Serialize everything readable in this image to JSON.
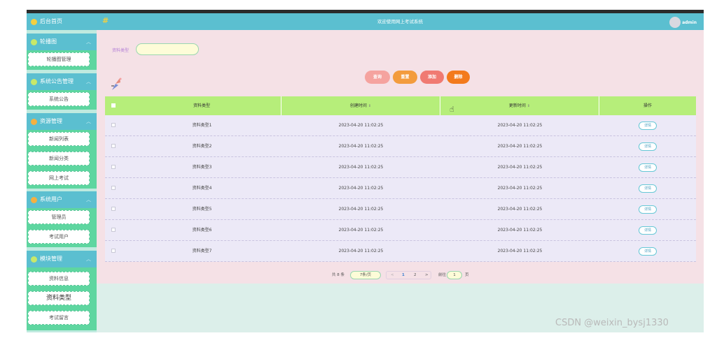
{
  "header": {
    "site_title": "欢迎使用网上考试系统",
    "admin_name": "admin"
  },
  "sidebar": {
    "home": "后台首页",
    "groups": [
      {
        "label": "轮播图",
        "items": [
          "轮播图管理"
        ]
      },
      {
        "label": "系统公告管理",
        "items": [
          "系统公告"
        ]
      },
      {
        "label": "资源管理",
        "items": [
          "新闻列表",
          "新闻分类",
          "网上考试"
        ]
      },
      {
        "label": "系统用户",
        "items": [
          "管理员",
          "考试用户"
        ]
      },
      {
        "label": "模块管理",
        "items": [
          "资料信息",
          "资料类型",
          "考试留言"
        ]
      }
    ]
  },
  "filter": {
    "label": "资料类型",
    "value": ""
  },
  "buttons": {
    "search": "查询",
    "reset": "重置",
    "add": "添加",
    "delete": "删除"
  },
  "table": {
    "columns": [
      "资料类型",
      "创建时间",
      "更新时间",
      "操作"
    ],
    "rows": [
      {
        "type": "资料类型1",
        "created": "2023-04-20 11:02:25",
        "updated": "2023-04-20 11:02:25",
        "action": "详情"
      },
      {
        "type": "资料类型2",
        "created": "2023-04-20 11:02:25",
        "updated": "2023-04-20 11:02:25",
        "action": "详情"
      },
      {
        "type": "资料类型3",
        "created": "2023-04-20 11:02:25",
        "updated": "2023-04-20 11:02:25",
        "action": "详情"
      },
      {
        "type": "资料类型4",
        "created": "2023-04-20 11:02:25",
        "updated": "2023-04-20 11:02:25",
        "action": "详情"
      },
      {
        "type": "资料类型5",
        "created": "2023-04-20 11:02:25",
        "updated": "2023-04-20 11:02:25",
        "action": "详情"
      },
      {
        "type": "资料类型6",
        "created": "2023-04-20 11:02:25",
        "updated": "2023-04-20 11:02:25",
        "action": "详情"
      },
      {
        "type": "资料类型7",
        "created": "2023-04-20 11:02:25",
        "updated": "2023-04-20 11:02:25",
        "action": "详情"
      }
    ]
  },
  "pager": {
    "total": "共 8 条",
    "page_size": "7条/页",
    "prev": "<",
    "page1": "1",
    "page2": "2",
    "next": ">",
    "goto_label": "前往",
    "goto_value": "1",
    "goto_unit": "页"
  },
  "watermark": "CSDN @weixin_bysj1330",
  "colors": {
    "header": "#5bbfd0",
    "table_header": "#b6ee7a",
    "main_bg": "#f5e1e6",
    "sidebar_bg": "#bfeadf"
  }
}
